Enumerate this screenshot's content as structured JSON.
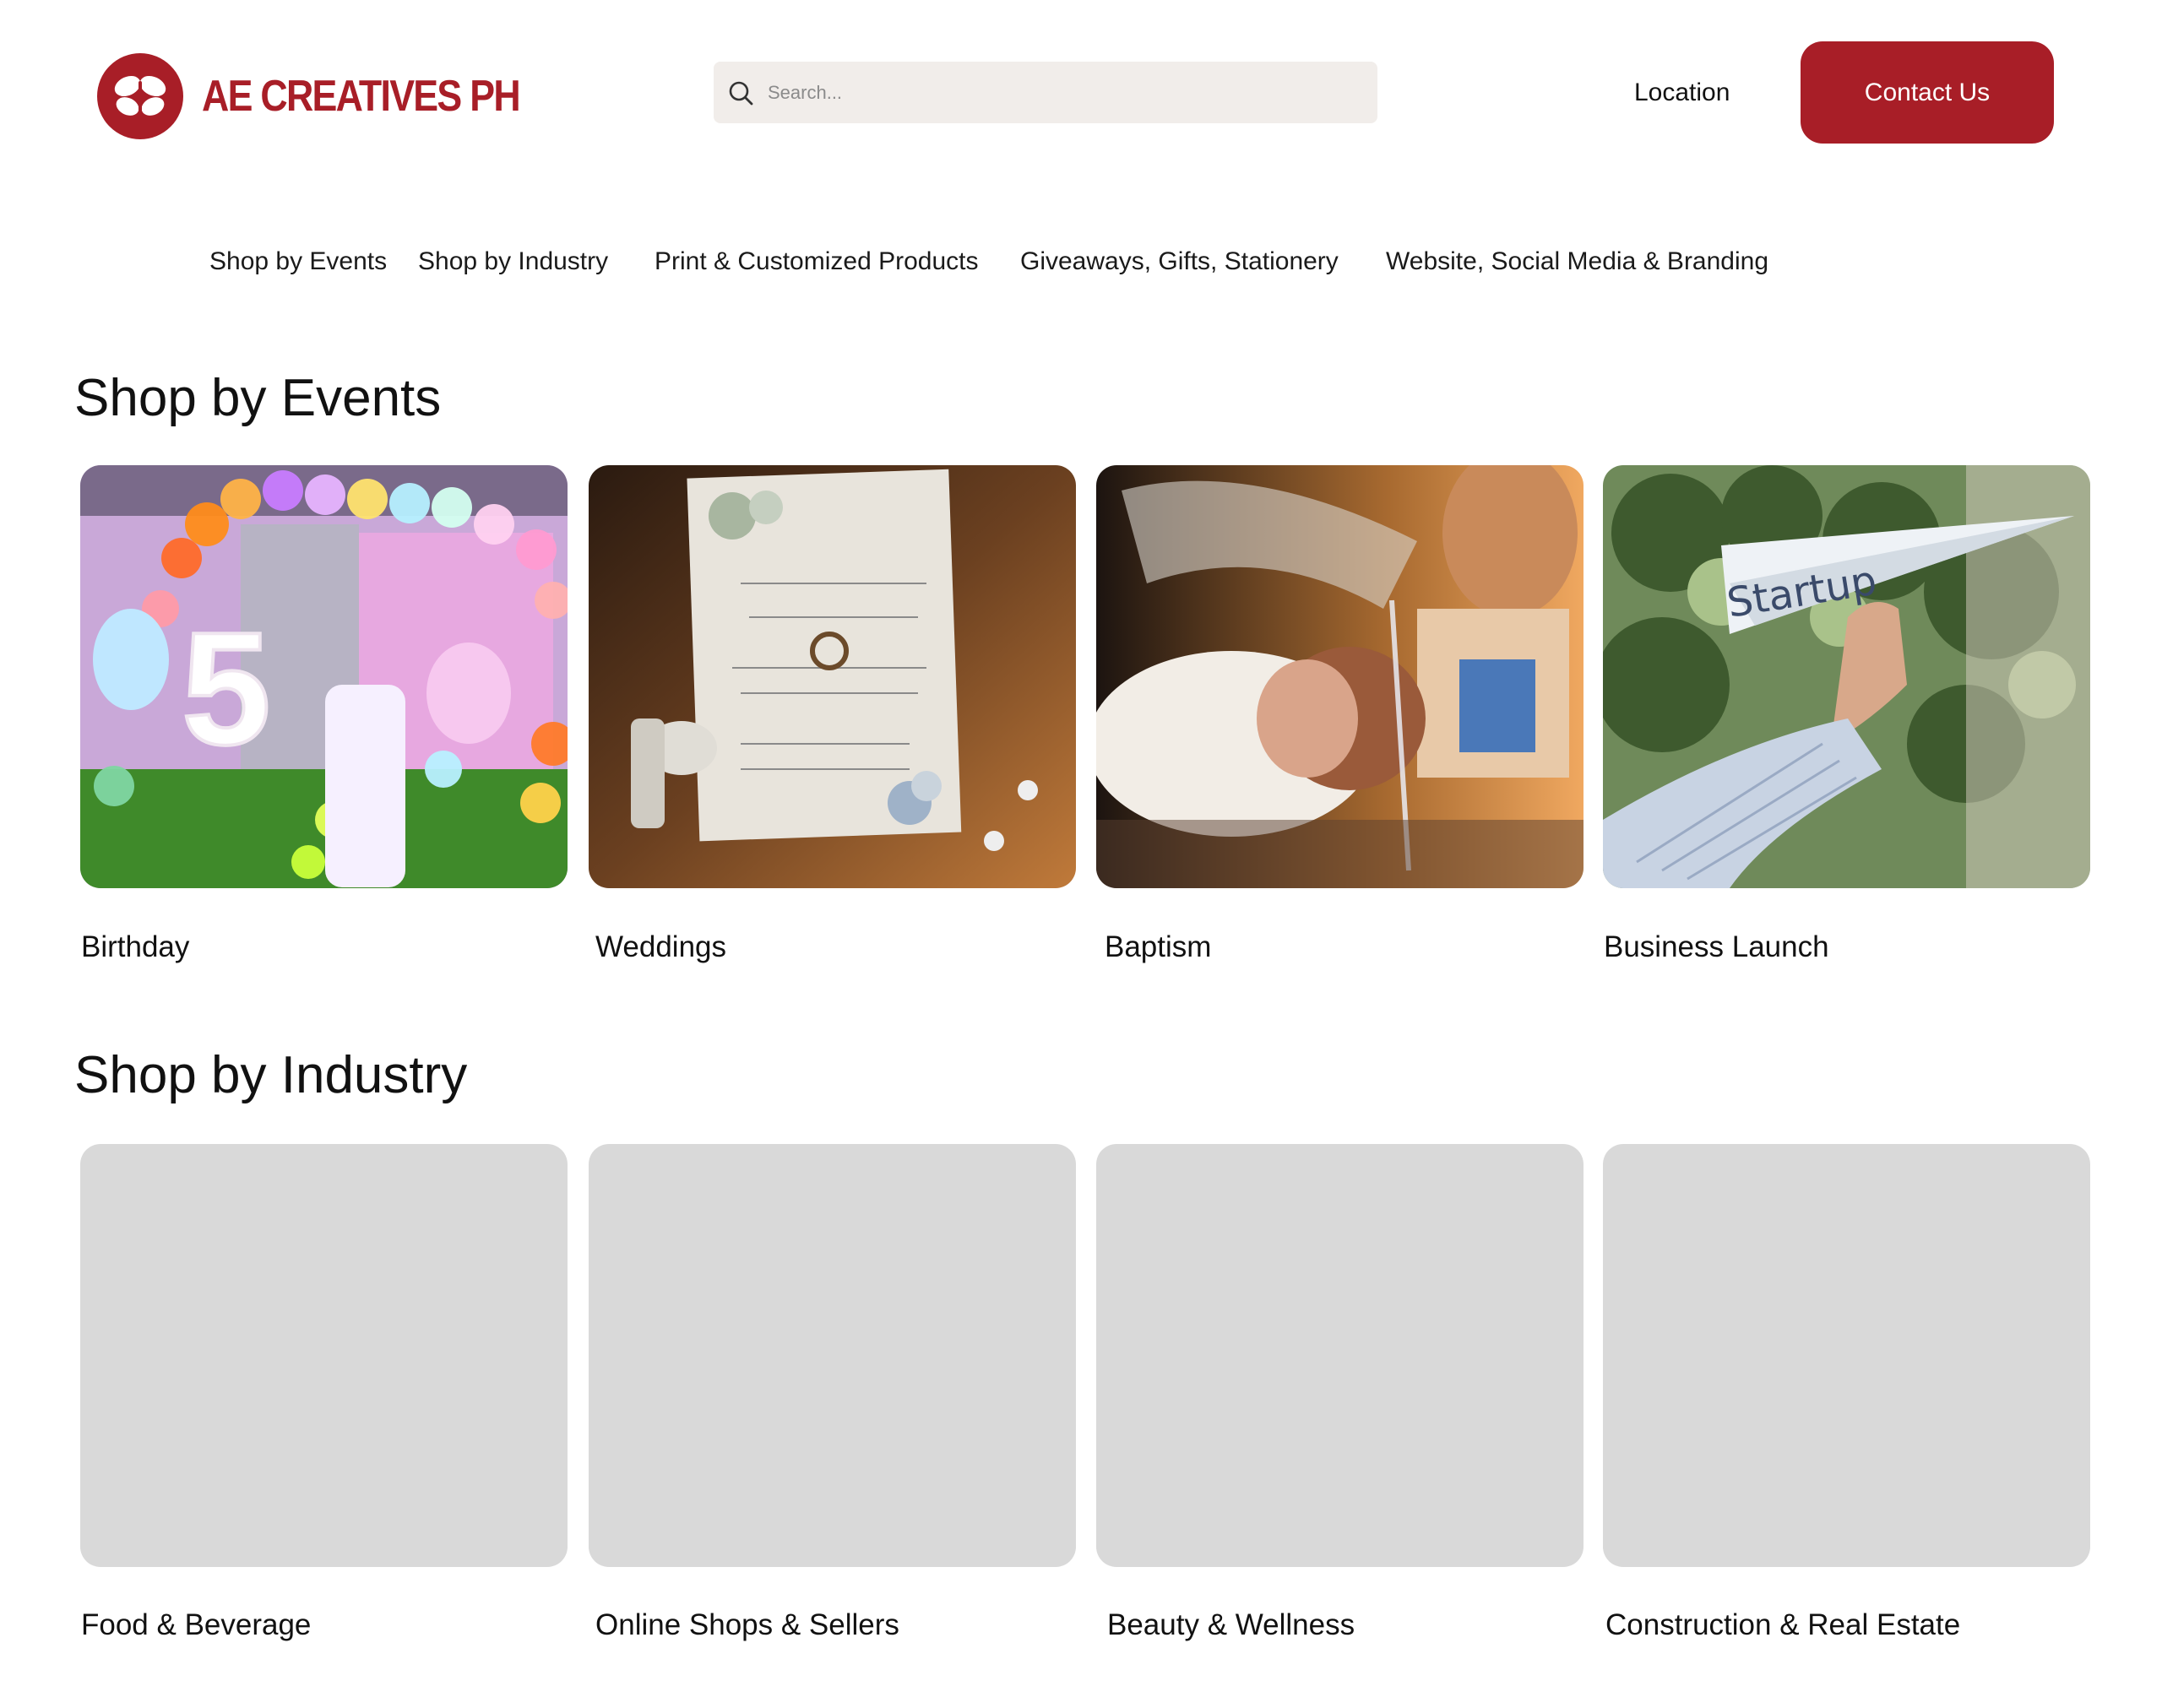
{
  "brand": {
    "name": "AE CREATIVES PH",
    "color": "#a81e27",
    "logo_icon": "butterfly-icon"
  },
  "search": {
    "placeholder": "Search...",
    "value": "",
    "icon": "search-icon"
  },
  "header": {
    "location_label": "Location",
    "contact_label": "Contact Us"
  },
  "nav": {
    "items": [
      {
        "label": "Shop by Events"
      },
      {
        "label": "Shop by Industry"
      },
      {
        "label": "Print & Customized Products"
      },
      {
        "label": "Giveaways, Gifts, Stationery"
      },
      {
        "label": "Website, Social Media & Branding"
      }
    ]
  },
  "events": {
    "title": "Shop by Events",
    "cards": [
      {
        "label": "Birthday",
        "image": "birthday-party-photo"
      },
      {
        "label": "Weddings",
        "image": "wedding-invitation-photo"
      },
      {
        "label": "Baptism",
        "image": "baptism-photo"
      },
      {
        "label": "Business Launch",
        "image": "startup-paper-plane-photo"
      }
    ]
  },
  "industry": {
    "title": "Shop by Industry",
    "cards": [
      {
        "label": "Food & Beverage"
      },
      {
        "label": "Online Shops & Sellers"
      },
      {
        "label": "Beauty & Wellness"
      },
      {
        "label": "Construction & Real Estate"
      }
    ]
  },
  "colors": {
    "accent": "#a81e27",
    "search_bg": "#f1edea",
    "placeholder_card": "#d9d9d9"
  }
}
